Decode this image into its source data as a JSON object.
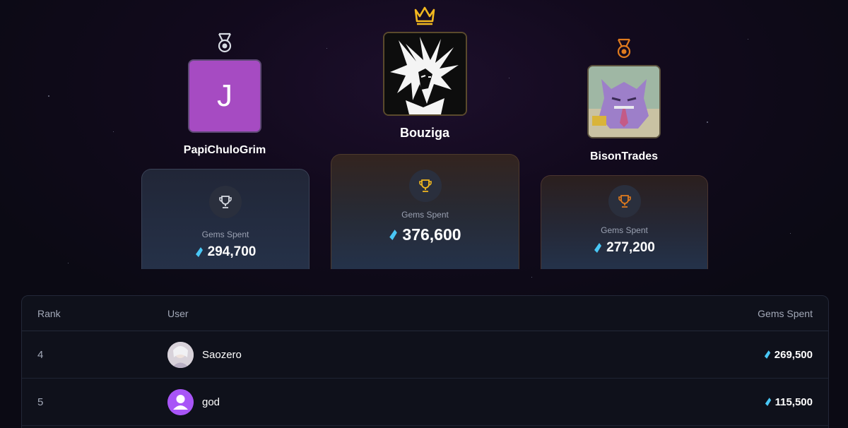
{
  "podium": {
    "first": {
      "username": "Bouziga",
      "gems_label": "Gems Spent",
      "gems": "376,600",
      "medal_icon": "crown-icon",
      "accent": "#f2b81f"
    },
    "second": {
      "username": "PapiChuloGrim",
      "avatar_letter": "J",
      "gems_label": "Gems Spent",
      "gems": "294,700",
      "medal_icon": "silver-medal-icon",
      "accent": "#d7dbe3"
    },
    "third": {
      "username": "BisonTrades",
      "gems_label": "Gems Spent",
      "gems": "277,200",
      "medal_icon": "bronze-medal-icon",
      "accent": "#e07b1e"
    }
  },
  "table": {
    "headers": {
      "rank": "Rank",
      "user": "User",
      "gems": "Gems Spent"
    },
    "rows": [
      {
        "rank": "4",
        "username": "Saozero",
        "gems": "269,500"
      },
      {
        "rank": "5",
        "username": "god",
        "gems": "115,500"
      }
    ]
  },
  "colors": {
    "gem": "#49c7f5",
    "avatar_purple": "#a64bc2"
  }
}
